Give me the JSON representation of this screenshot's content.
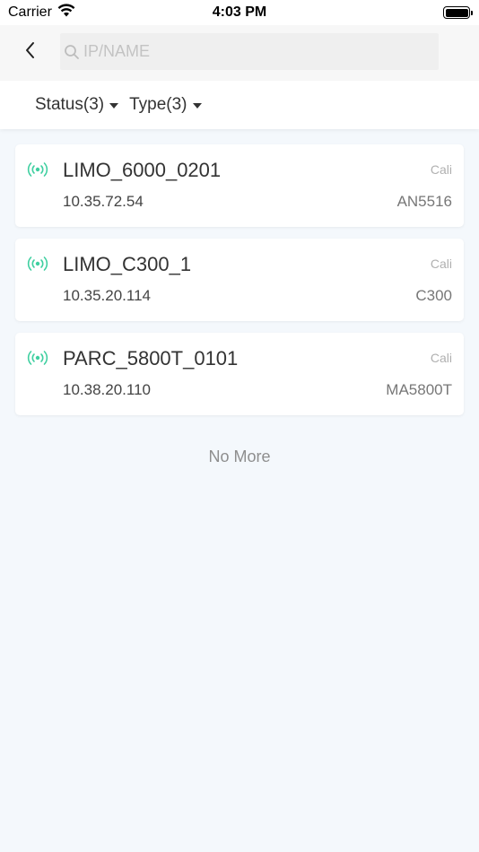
{
  "status_bar": {
    "carrier": "Carrier",
    "time": "4:03 PM",
    "wifi_icon": "wifi-icon",
    "battery_icon": "battery-icon"
  },
  "nav": {
    "back_icon": "chevron-left-icon",
    "search": {
      "placeholder": "IP/NAME",
      "value": "",
      "icon": "search-icon"
    }
  },
  "filters": [
    {
      "label": "Status(3)",
      "icon": "caret-down-icon"
    },
    {
      "label": "Type(3)",
      "icon": "caret-down-icon"
    }
  ],
  "devices": [
    {
      "name": "LIMO_6000_0201",
      "ip": "10.35.72.54",
      "region": "Cali",
      "model": "AN5516",
      "status_icon": "signal-broadcast-icon"
    },
    {
      "name": "LIMO_C300_1",
      "ip": "10.35.20.114",
      "region": "Cali",
      "model": "C300",
      "status_icon": "signal-broadcast-icon"
    },
    {
      "name": "PARC_5800T_0101",
      "ip": "10.38.20.110",
      "region": "Cali",
      "model": "MA5800T",
      "status_icon": "signal-broadcast-icon"
    }
  ],
  "footer": {
    "no_more": "No More"
  },
  "colors": {
    "online_accent": "#3fcfa0",
    "background": "#f4f8fc",
    "card": "#ffffff"
  }
}
